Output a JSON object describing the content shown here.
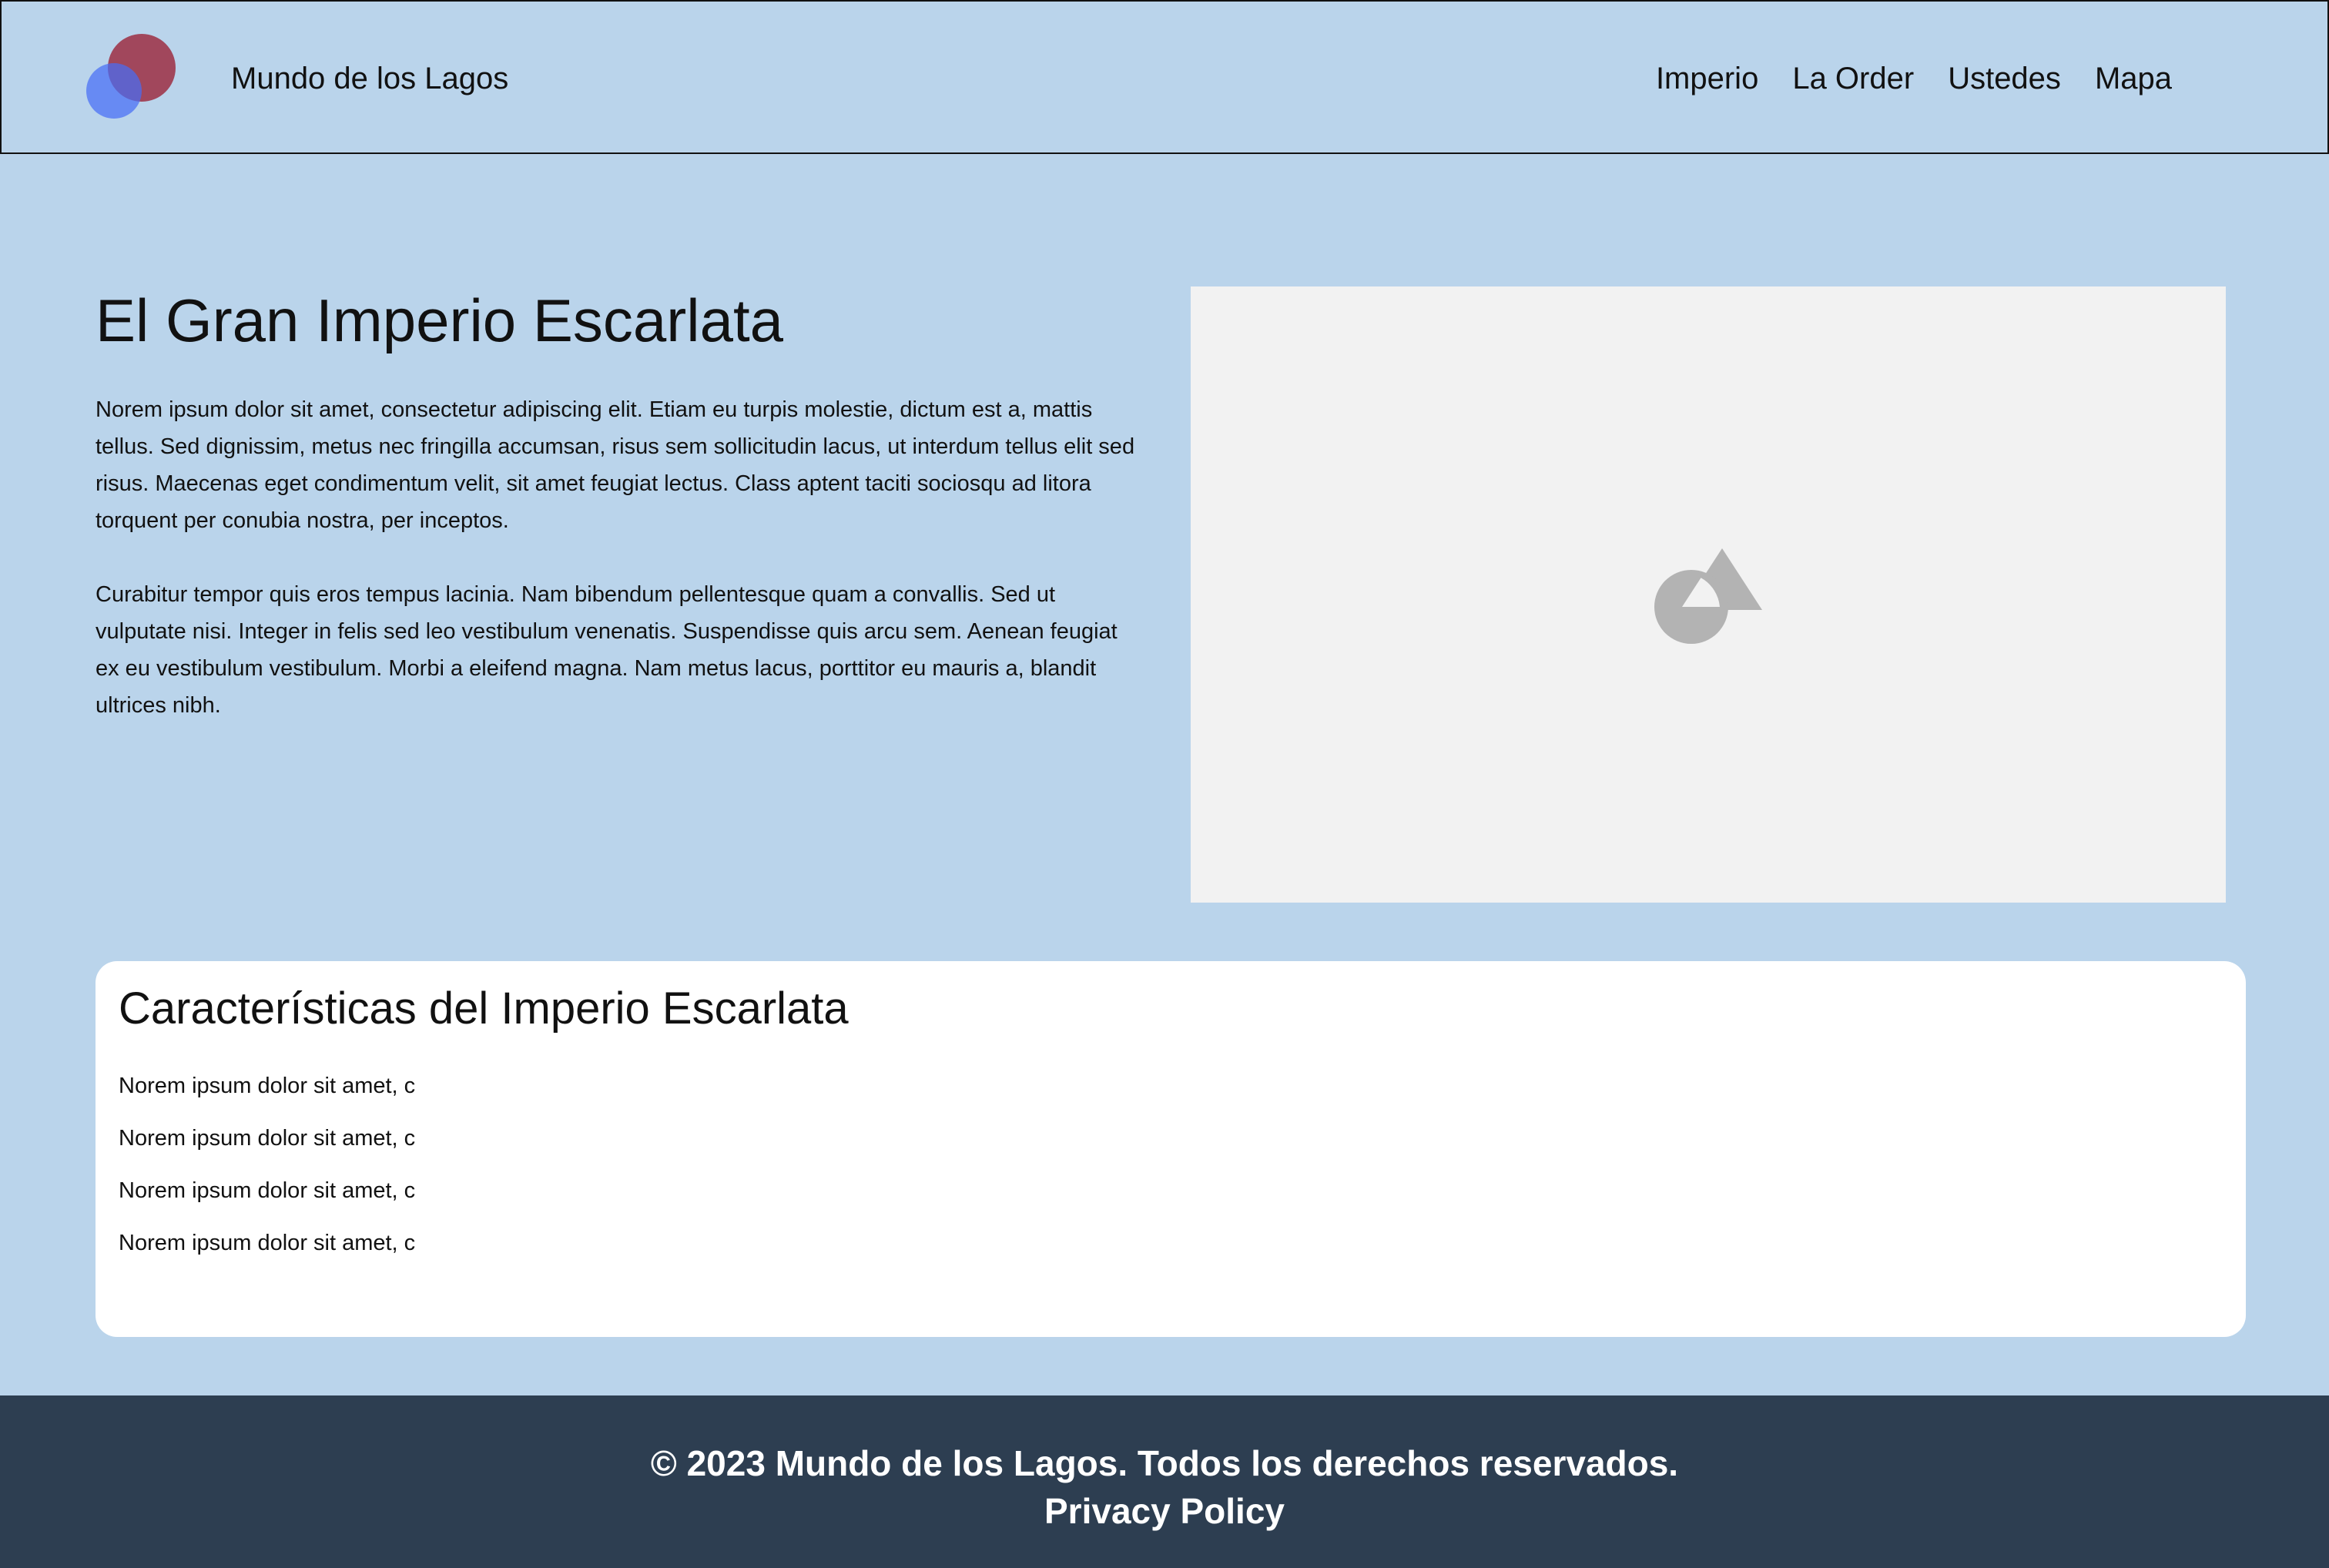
{
  "header": {
    "brand": "Mundo de los Lagos",
    "nav": [
      {
        "label": "Imperio"
      },
      {
        "label": "La Order"
      },
      {
        "label": "Ustedes"
      },
      {
        "label": "Mapa"
      }
    ]
  },
  "hero": {
    "title": "El Gran Imperio Escarlata",
    "paragraphs": [
      "Norem ipsum dolor sit amet, consectetur adipiscing elit. Etiam eu turpis molestie, dictum est a, mattis tellus. Sed dignissim, metus nec fringilla accumsan, risus sem sollicitudin lacus, ut interdum tellus elit sed risus. Maecenas eget condimentum velit, sit amet feugiat lectus. Class aptent taciti sociosqu ad litora torquent per conubia nostra, per inceptos.",
      "Curabitur tempor quis eros tempus lacinia. Nam bibendum pellentesque quam a convallis. Sed ut vulputate nisi. Integer in felis sed leo vestibulum venenatis. Suspendisse quis arcu sem. Aenean feugiat ex eu vestibulum vestibulum. Morbi a eleifend magna. Nam metus lacus, porttitor eu mauris a, blandit ultrices nibh."
    ],
    "image_icon": "image-placeholder-icon"
  },
  "features": {
    "title": "Características del Imperio Escarlata",
    "items": [
      "Norem ipsum dolor sit amet, c",
      "Norem ipsum dolor sit amet, c",
      "Norem ipsum dolor sit amet, c",
      "Norem ipsum dolor sit amet, c"
    ]
  },
  "footer": {
    "copyright": "© 2023 Mundo de los Lagos. Todos los derechos reservados.",
    "privacy_link": "Privacy Policy"
  },
  "colors": {
    "page_background": "#bad4eb",
    "footer_background": "#2d3e51",
    "card_background": "#ffffff",
    "placeholder_background": "#f2f2f2",
    "logo_red": "#9b283c",
    "logo_blue": "#466ef5"
  }
}
